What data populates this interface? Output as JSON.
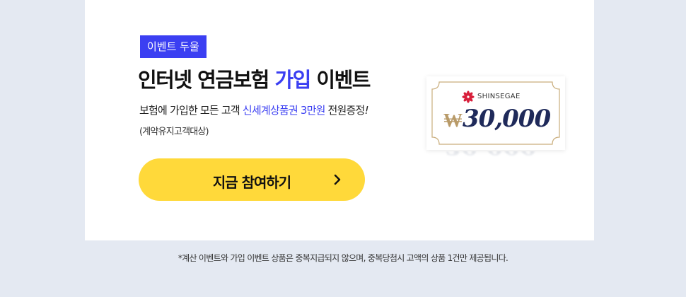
{
  "event": {
    "badge": "이벤트 두울",
    "title_part1": "인터넷 연금보험 ",
    "title_accent": "가입",
    "title_part2": " 이벤트",
    "desc_part1": "보험에 가입한 모든 고객 ",
    "desc_accent": "신세계상품권 3만원",
    "desc_part2": " 전원증정",
    "desc_exclaim": "!",
    "sub": "(계약유지고객대상)",
    "cta_label": "지금 참여하기"
  },
  "gift_card": {
    "brand": "SHINSEGAE",
    "currency": "₩",
    "amount": "30,000"
  },
  "footnote": "*계산 이벤트와 가입 이벤트 상품은 중복지급되지 않으며, 중복당첨시 고액의 상품 1건만 제공됩니다.",
  "colors": {
    "accent": "#3b3ff2",
    "cta": "#ffd93a",
    "card_border": "#c9ad7c",
    "brand_logo": "#d81e3a",
    "amount": "#1f2a5a",
    "background": "#e4e9f2"
  },
  "icons": {
    "cta": "chevron-right-icon",
    "brand": "shinsegae-flower-logo"
  }
}
